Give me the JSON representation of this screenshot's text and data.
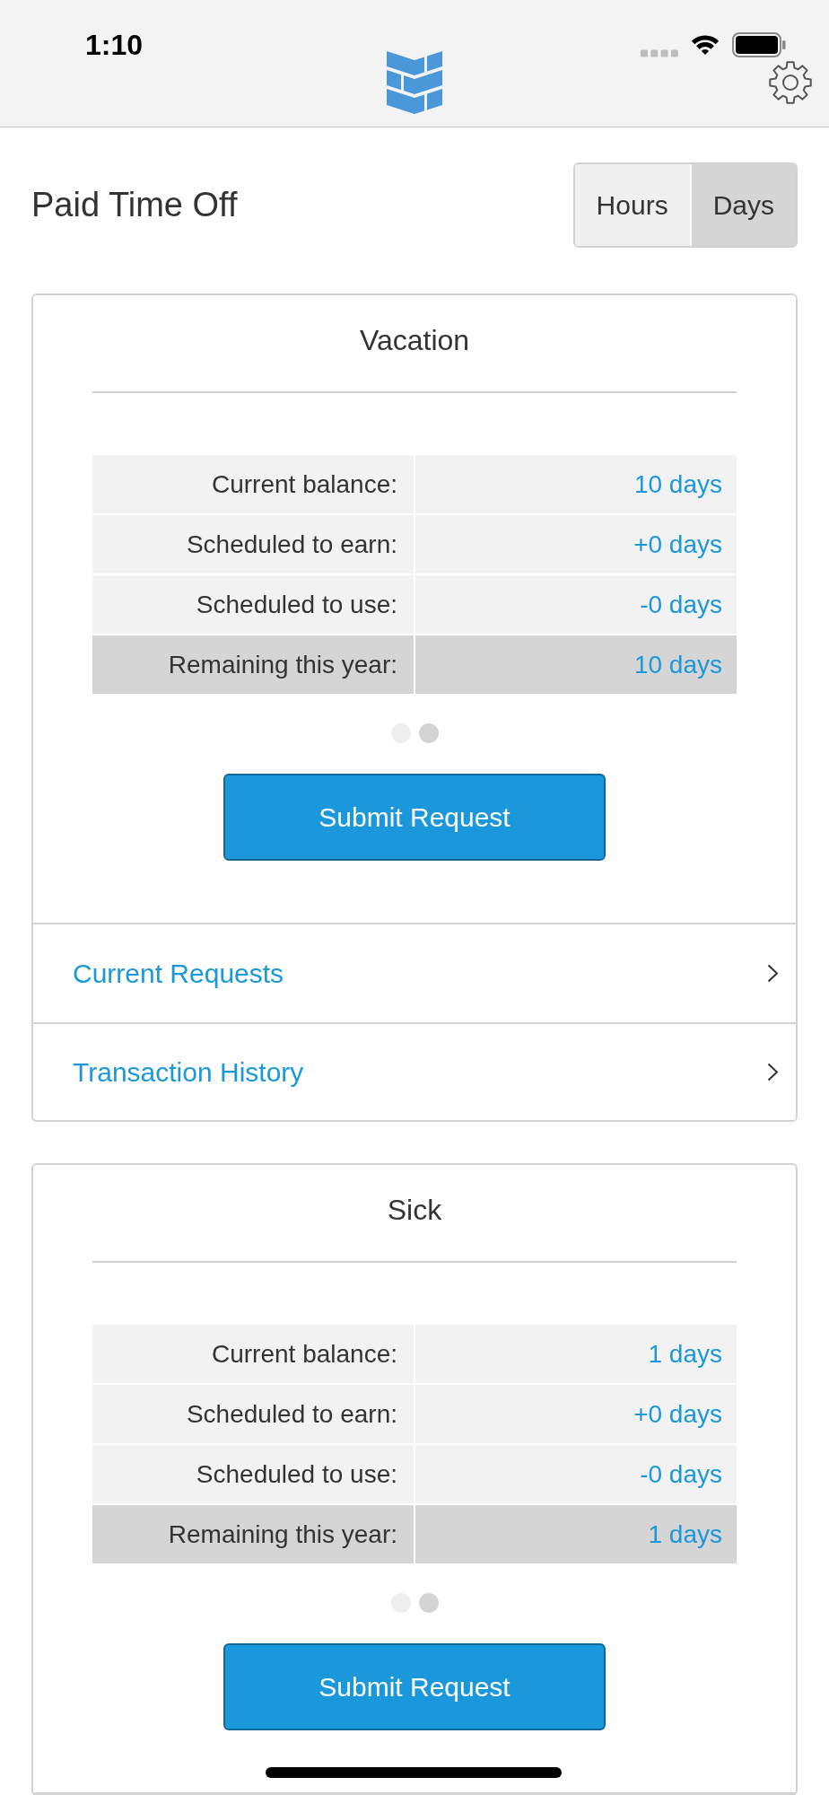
{
  "status_bar": {
    "time": "1:10"
  },
  "page": {
    "title": "Paid Time Off",
    "unit_toggle": [
      {
        "label": "Hours",
        "selected": false
      },
      {
        "label": "Days",
        "selected": true
      }
    ]
  },
  "cards": [
    {
      "title": "Vacation",
      "rows": [
        {
          "kind": "detail",
          "label": "Current balance:",
          "value": "10 days"
        },
        {
          "kind": "detail",
          "label": "Scheduled to earn:",
          "value": "+0 days"
        },
        {
          "kind": "detail",
          "label": "Scheduled to use:",
          "value": "-0 days"
        },
        {
          "kind": "total",
          "label": "Remaining this year:",
          "value": "10 days"
        }
      ],
      "pager": [
        {
          "selected": false
        },
        {
          "selected": true
        }
      ],
      "button": "Submit Request",
      "links": [
        "Current Requests",
        "Transaction History"
      ]
    },
    {
      "title": "Sick",
      "rows": [
        {
          "kind": "detail",
          "label": "Current balance:",
          "value": "1 days"
        },
        {
          "kind": "detail",
          "label": "Scheduled to earn:",
          "value": "+0 days"
        },
        {
          "kind": "detail",
          "label": "Scheduled to use:",
          "value": "-0 days"
        },
        {
          "kind": "total",
          "label": "Remaining this year:",
          "value": "1 days"
        }
      ],
      "pager": [
        {
          "selected": false
        },
        {
          "selected": true
        }
      ],
      "button": "Submit Request"
    }
  ]
}
